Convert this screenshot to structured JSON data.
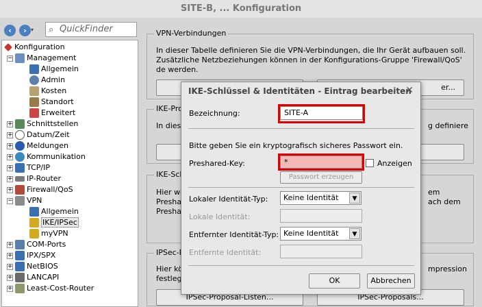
{
  "window": {
    "title": "SITE-B, ... Konfiguration"
  },
  "navbar": {
    "back_icon": "back-arrow-icon",
    "forward_icon": "forward-arrow-icon",
    "quickfinder_placeholder": "QuickFinder"
  },
  "tree": {
    "items": [
      {
        "label": "Konfiguration",
        "icon": "wrench-icon"
      },
      {
        "label": "Management",
        "icon": "computer-icon",
        "toggle": "−"
      },
      {
        "label": "Allgemein",
        "icon": "network-icon"
      },
      {
        "label": "Admin",
        "icon": "user-icon"
      },
      {
        "label": "Kosten",
        "icon": "calculator-icon"
      },
      {
        "label": "Standort",
        "icon": "pin-icon"
      },
      {
        "label": "Erweitert",
        "icon": "cube-icon"
      },
      {
        "label": "Schnittstellen",
        "icon": "chip-icon",
        "toggle": "+"
      },
      {
        "label": "Datum/Zeit",
        "icon": "clock-icon",
        "toggle": "+"
      },
      {
        "label": "Meldungen",
        "icon": "info-icon",
        "toggle": "+"
      },
      {
        "label": "Kommunikation",
        "icon": "globe-icon",
        "toggle": "+"
      },
      {
        "label": "TCP/IP",
        "icon": "network-icon",
        "toggle": "+"
      },
      {
        "label": "IP-Router",
        "icon": "router-icon",
        "toggle": "+"
      },
      {
        "label": "Firewall/QoS",
        "icon": "wall-icon",
        "toggle": "+"
      },
      {
        "label": "VPN",
        "icon": "lock-icon",
        "toggle": "−"
      },
      {
        "label": "Allgemein",
        "icon": "network-icon"
      },
      {
        "label": "IKE/IPSec",
        "icon": "key-icon"
      },
      {
        "label": "myVPN",
        "icon": "key-icon"
      },
      {
        "label": "COM-Ports",
        "icon": "port-icon",
        "toggle": "+"
      },
      {
        "label": "IPX/SPX",
        "icon": "network-icon",
        "toggle": "+"
      },
      {
        "label": "NetBIOS",
        "icon": "network-icon",
        "toggle": "+"
      },
      {
        "label": "LANCAPI",
        "icon": "phone-icon",
        "toggle": "+"
      },
      {
        "label": "Least-Cost-Router",
        "icon": "money-icon",
        "toggle": "+"
      }
    ]
  },
  "main": {
    "vpn_group": {
      "title": "VPN-Verbindungen",
      "text": "In dieser Tabelle definieren Sie die VPN-Verbindungen, die Ihr Gerät aufbauen soll. Zusätzliche Netzbeziehungen können in der Konfigurations-Gruppe 'Firewall/QoS' de werden.",
      "button_right": "er..."
    },
    "ike_group": {
      "title": "IKE-Prop",
      "text_left": "In dies",
      "text_right": "g definiere"
    },
    "ikes_group": {
      "title": "IKE-Sch",
      "text_left_1": "Hier we",
      "text_left_2": "Presha",
      "text_left_3": "Presha",
      "text_right_1": "em",
      "text_right_2": "ach dem"
    },
    "ipsec_group": {
      "title": "IPSec-P",
      "text_left_1": "Hier kö",
      "text_left_2": "festleg",
      "text_right": "mpression",
      "button_left": "IPSec-Proposal-Listen...",
      "button_right": "IPSec-Proposals..."
    }
  },
  "dialog": {
    "title": "IKE-Schlüssel & Identitäten - Eintrag bearbeiten",
    "close_icon": "close-icon",
    "bezeichnung_label": "Bezeichnung:",
    "bezeichnung_value": "SITE-A",
    "info_text": "Bitte geben Sie ein kryptografisch sicheres Passwort ein.",
    "psk_label": "Preshared-Key:",
    "psk_value": "*",
    "show_label": "Anzeigen",
    "generate_button": "Passwort erzeugen",
    "local_type_label": "Lokaler Identität-Typ:",
    "local_type_value": "Keine Identität",
    "local_id_label": "Lokale Identität:",
    "remote_type_label": "Entfernter Identität-Typ:",
    "remote_type_value": "Keine Identität",
    "remote_id_label": "Entfernte Identität:",
    "ok_button": "OK",
    "cancel_button": "Abbrechen"
  }
}
